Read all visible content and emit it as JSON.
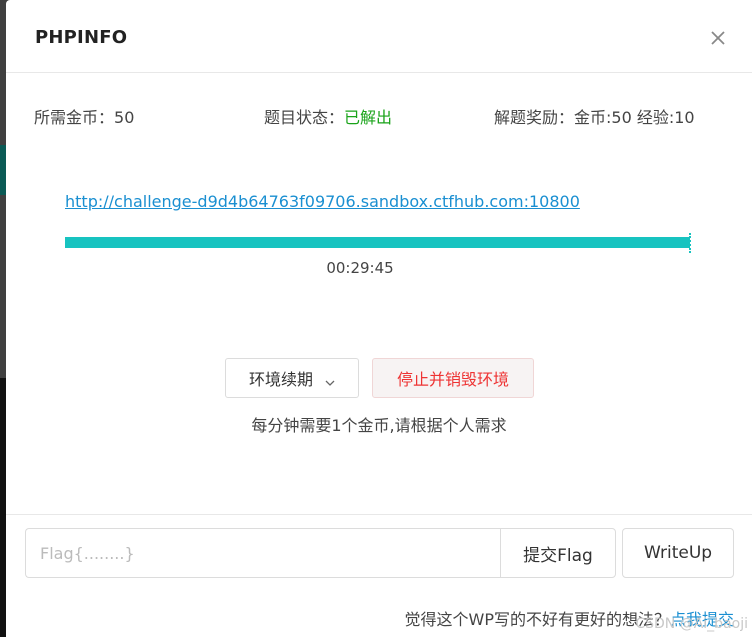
{
  "modal": {
    "title": "PHPINFO"
  },
  "info": {
    "cost_label": "所需金币：",
    "cost_value": "50",
    "status_label": "题目状态：",
    "status_value": "已解出",
    "reward_label": "解题奖励：",
    "reward_value": "金币:50 经验:10"
  },
  "environment": {
    "url": "http://challenge-d9d4b64763f09706.sandbox.ctfhub.com:10800",
    "remaining_fraction": 1.0,
    "timer": "00:29:45"
  },
  "actions": {
    "renew_label": "环境续期",
    "destroy_label": "停止并销毁环境",
    "note": "每分钟需要1个金币,请根据个人需求"
  },
  "footer": {
    "flag_placeholder": "Flag{........}",
    "submit_label": "提交Flag",
    "writeup_label": "WriteUp",
    "prompt_text": "觉得这个WP写的不好有更好的想法？",
    "prompt_link": "点我提交",
    "watermark": "CSDN @Ai_baoji"
  },
  "colors": {
    "progress": "#17c3c0",
    "link": "#1a8fd1",
    "solved": "#19a319",
    "destroy": "#e33333"
  },
  "icons": {
    "close": "close-icon",
    "chevron": "chevron-down-icon"
  }
}
